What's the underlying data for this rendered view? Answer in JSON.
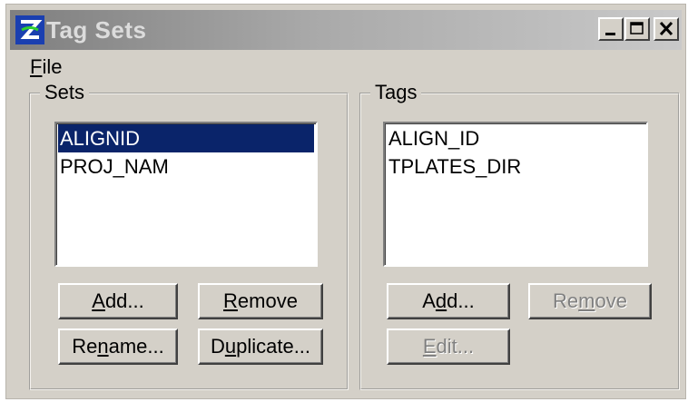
{
  "window": {
    "title": "Tag Sets"
  },
  "menu": [
    {
      "label": "File",
      "mnemonic": "F",
      "rest": "ile"
    }
  ],
  "sets": {
    "legend": "Sets",
    "items": [
      {
        "label": "ALIGNID",
        "selected": true
      },
      {
        "label": "PROJ_NAM",
        "selected": false
      }
    ],
    "buttons": {
      "add": {
        "pre": "",
        "u": "A",
        "post": "dd...",
        "enabled": true
      },
      "remove": {
        "pre": "",
        "u": "R",
        "post": "emove",
        "enabled": true
      },
      "rename": {
        "pre": "Re",
        "u": "n",
        "post": "ame...",
        "enabled": true
      },
      "duplicate": {
        "pre": "D",
        "u": "u",
        "post": "plicate...",
        "enabled": true
      }
    }
  },
  "tags": {
    "legend": "Tags",
    "items": [
      {
        "label": "ALIGN_ID"
      },
      {
        "label": "TPLATES_DIR"
      }
    ],
    "buttons": {
      "add": {
        "pre": "A",
        "u": "d",
        "post": "d...",
        "enabled": true
      },
      "remove": {
        "pre": "Re",
        "u": "m",
        "post": "ove",
        "enabled": false
      },
      "edit": {
        "pre": "",
        "u": "E",
        "post": "dit...",
        "enabled": false
      }
    }
  },
  "colors": {
    "face": "#d4d0c8",
    "selection": "#0a246a",
    "disabled_text": "#808080"
  }
}
